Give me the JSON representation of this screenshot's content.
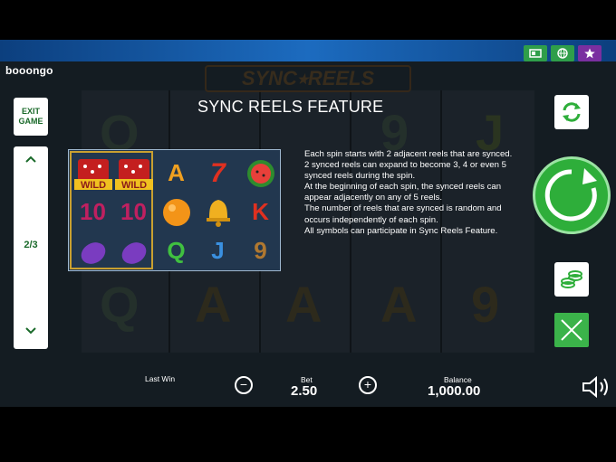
{
  "top_bar": {
    "buttons": [
      "paytable-icon",
      "globe-icon",
      "star-icon"
    ]
  },
  "brand": {
    "logo_text": "booongo",
    "game_logo": "SYNC⭑REELS"
  },
  "left_panel": {
    "exit_label": "EXIT\nGAME",
    "page_indicator": "2/3"
  },
  "info": {
    "title": "SYNC REELS FEATURE",
    "paragraphs": [
      "Each spin starts with 2 adjacent reels that are synced.",
      "2 synced reels can expand to become 3, 4 or even 5 synced reels during the spin.",
      "At the beginning of each spin, the synced reels can appear adjacently on any of 5 reels.",
      "The number of reels that are synced is random and occurs independently of each spin.",
      "All symbols can participate in Sync Reels Feature."
    ]
  },
  "example_grid": {
    "rows": [
      [
        "WILD",
        "WILD",
        "A",
        "7",
        "watermelon"
      ],
      [
        "10",
        "10",
        "orange",
        "bell",
        "K"
      ],
      [
        "plum",
        "plum",
        "Q",
        "J",
        "9"
      ]
    ]
  },
  "bottom_bar": {
    "last_win_label": "Last Win",
    "bet_label": "Bet",
    "bet_value": "2.50",
    "balance_label": "Balance",
    "balance_value": "1,000.00",
    "minus": "−",
    "plus": "+"
  },
  "colors": {
    "accent_green": "#2eae3a",
    "panel_bg": "#22374f",
    "top_bar": "#1c6bbf"
  }
}
